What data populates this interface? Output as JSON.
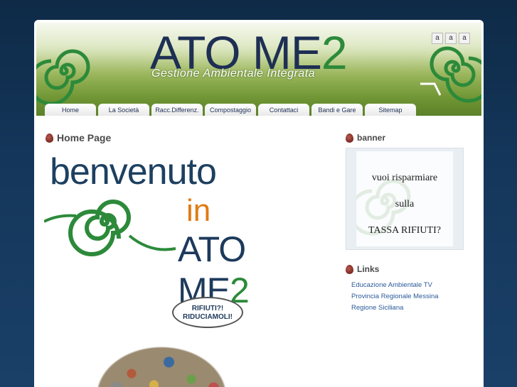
{
  "header": {
    "logo_ato": "ATO ",
    "logo_me": "ME",
    "logo_two": "2",
    "subtitle": "Gestione Ambientale Integrata",
    "font_sizer": [
      "a",
      "a",
      "a"
    ]
  },
  "nav": {
    "tabs": [
      {
        "label": "Home"
      },
      {
        "label": "La Società"
      },
      {
        "label": "Racc.Differenz."
      },
      {
        "label": "Compostaggio"
      },
      {
        "label": "Contattaci"
      },
      {
        "label": "Bandi e Gare"
      },
      {
        "label": "Sitemap"
      }
    ]
  },
  "main": {
    "title": "Home Page",
    "welcome_line1": "benvenuto",
    "welcome_line2": "in",
    "welcome_line3_a": "ATO ME",
    "welcome_line3_b": "2",
    "bubble_line1": "RIFIUTI?!",
    "bubble_line2": "RIDUCIAMOLI!"
  },
  "sidebar": {
    "banner_title": "banner",
    "banner_lines": [
      "vuoi risparmiare",
      "sulla",
      "TASSA RIFIUTI?"
    ],
    "links_title": "Links",
    "links": [
      {
        "label": "Educazione Ambientale TV"
      },
      {
        "label": "Provincia Regionale Messina"
      },
      {
        "label": "Regione Siciliana"
      }
    ]
  },
  "colors": {
    "background": "#14365a",
    "accent_green": "#2c8a3a",
    "accent_navy": "#1e2f54",
    "accent_orange": "#e07b14",
    "link": "#2a5a9a"
  }
}
